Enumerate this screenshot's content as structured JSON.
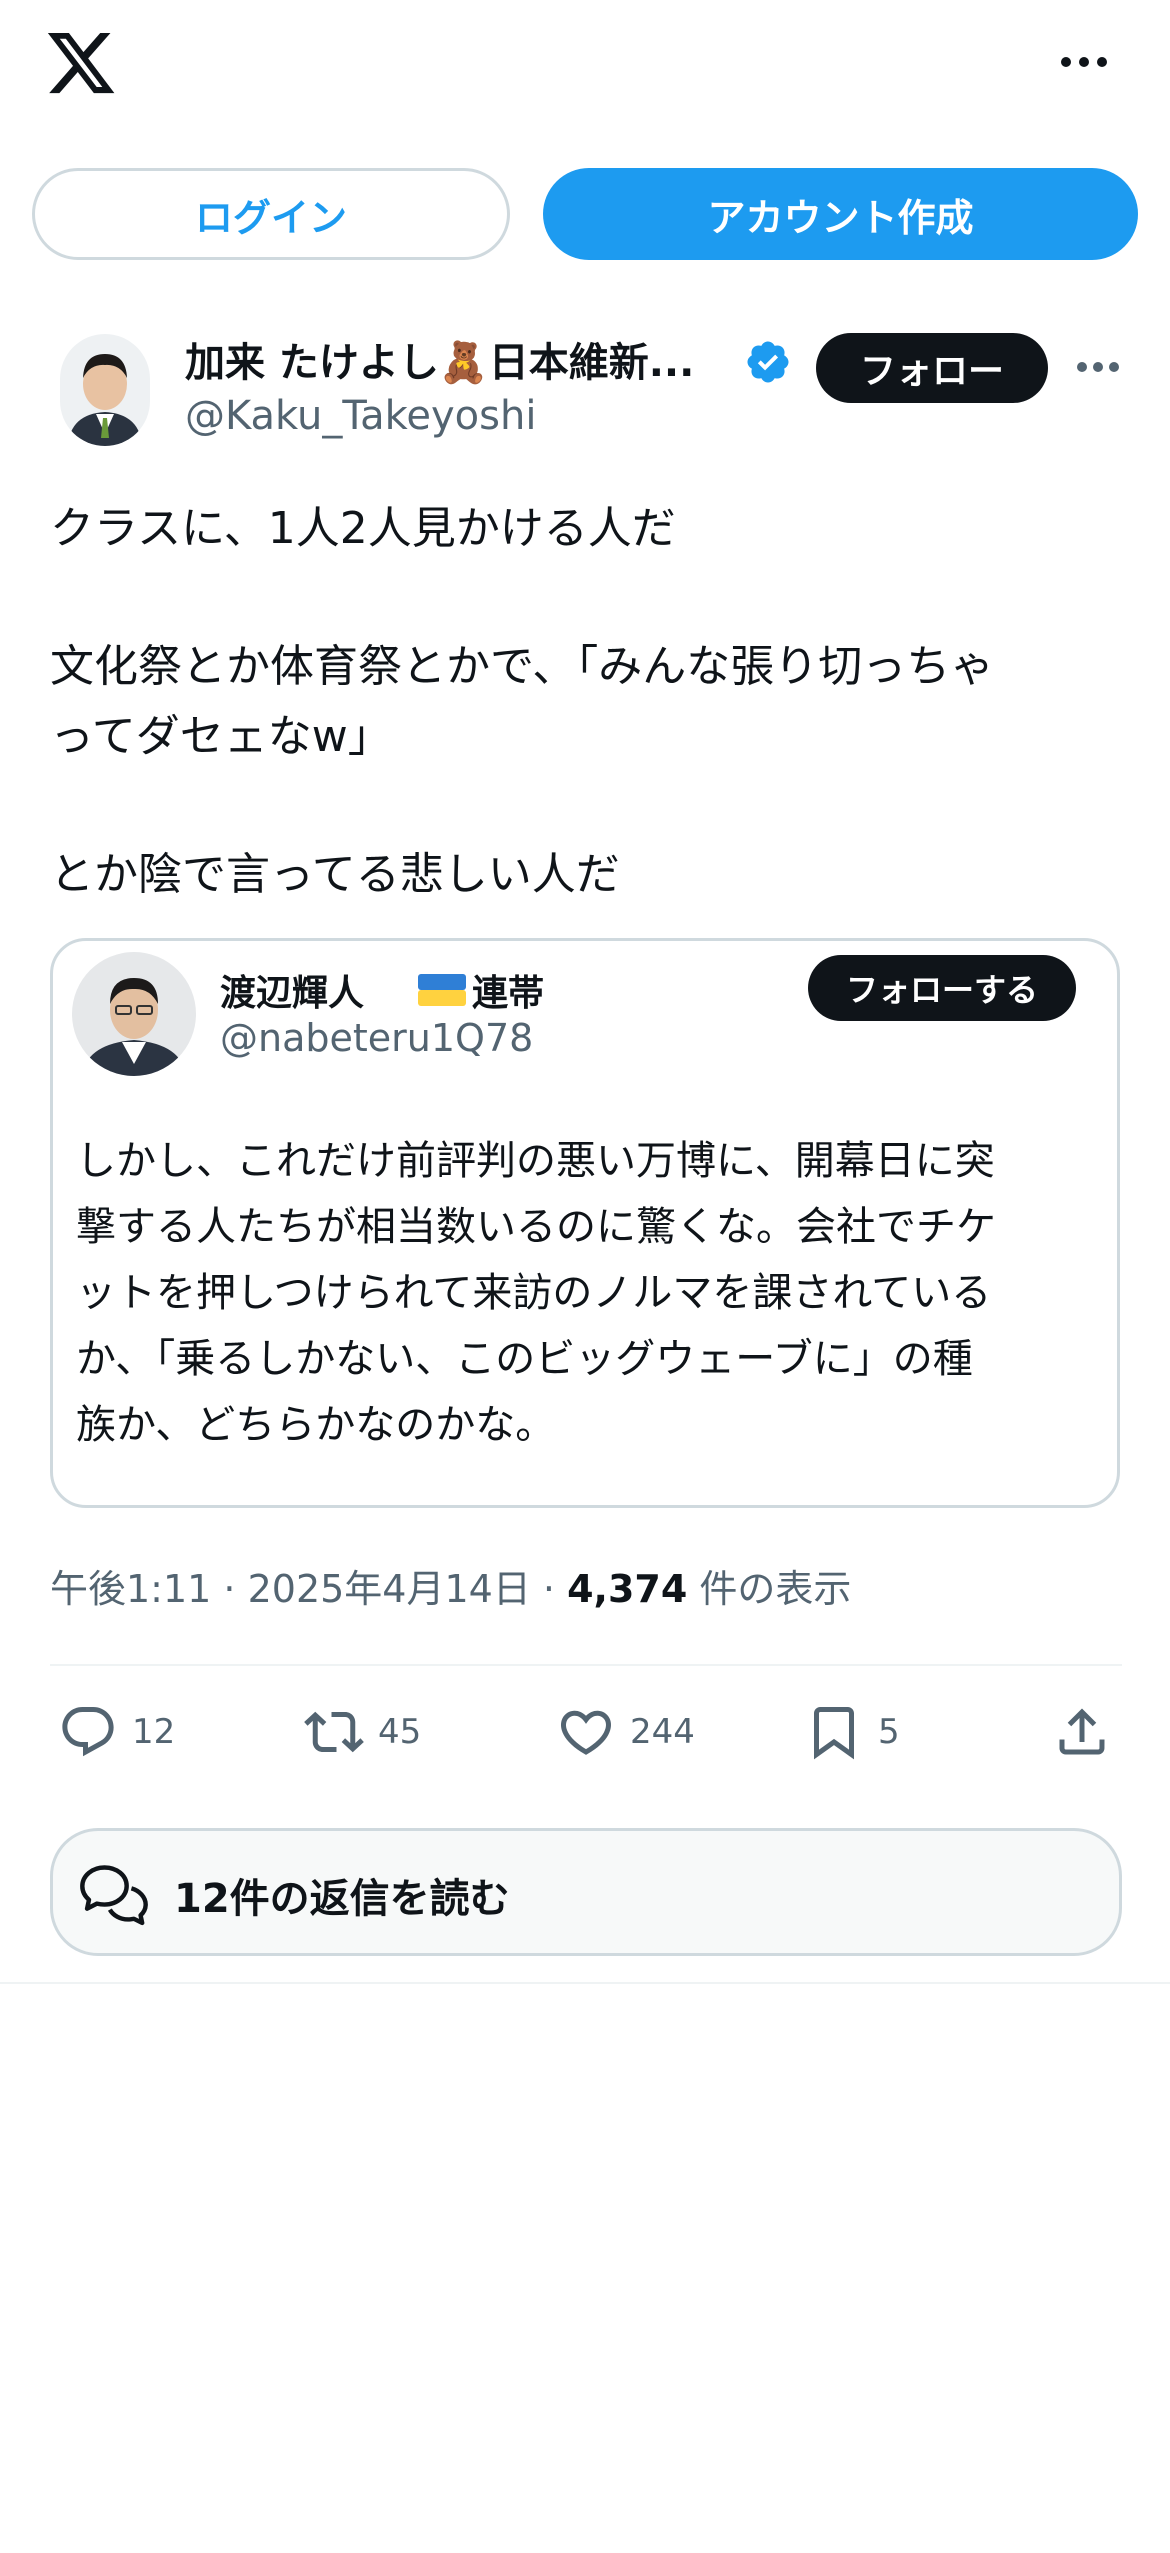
{
  "header": {
    "logo_icon": "x-logo-icon",
    "more_icon": "more-horizontal-icon",
    "login_label": "ログイン",
    "signup_label": "アカウント作成"
  },
  "tweet": {
    "author": {
      "name": "加来 たけよし🧸日本維新...",
      "handle": "@Kaku_Takeyoshi",
      "verified": true,
      "follow_label": "フォロー"
    },
    "text_lines": [
      "クラスに、1人2人見かける人だ",
      "文化祭とか体育祭とかで、「みんな張り切っちゃ",
      "ってダセェなw」",
      "とか陰で言ってる悲しい人だ"
    ],
    "quote": {
      "name": "渡辺輝人",
      "flag_icon": "ukraine-flag-icon",
      "badge": "連帯",
      "handle": "@nabeteru1Q78",
      "follow_label": "フォローする",
      "text_lines": [
        "しかし、これだけ前評判の悪い万博に、開幕日に突",
        "撃する人たちが相当数いるのに驚くな。会社でチケ",
        "ットを押しつけられて来訪のノルマを課されている",
        "か、「乗るしかない、このビッグウェーブに」の種",
        "族か、どちらかなのかな。"
      ]
    },
    "meta": {
      "time": "午後1:11",
      "separator": " · ",
      "date": "2025年4月14日",
      "views_count": "4,374",
      "views_label": " 件の表示"
    },
    "actions": {
      "replies": "12",
      "retweets": "45",
      "likes": "244",
      "bookmarks": "5"
    },
    "read_replies_label": "12件の返信を読む"
  },
  "colors": {
    "accent": "#1d9bf0",
    "text": "#0f1419",
    "secondary": "#536471",
    "border": "#cfd9de"
  }
}
